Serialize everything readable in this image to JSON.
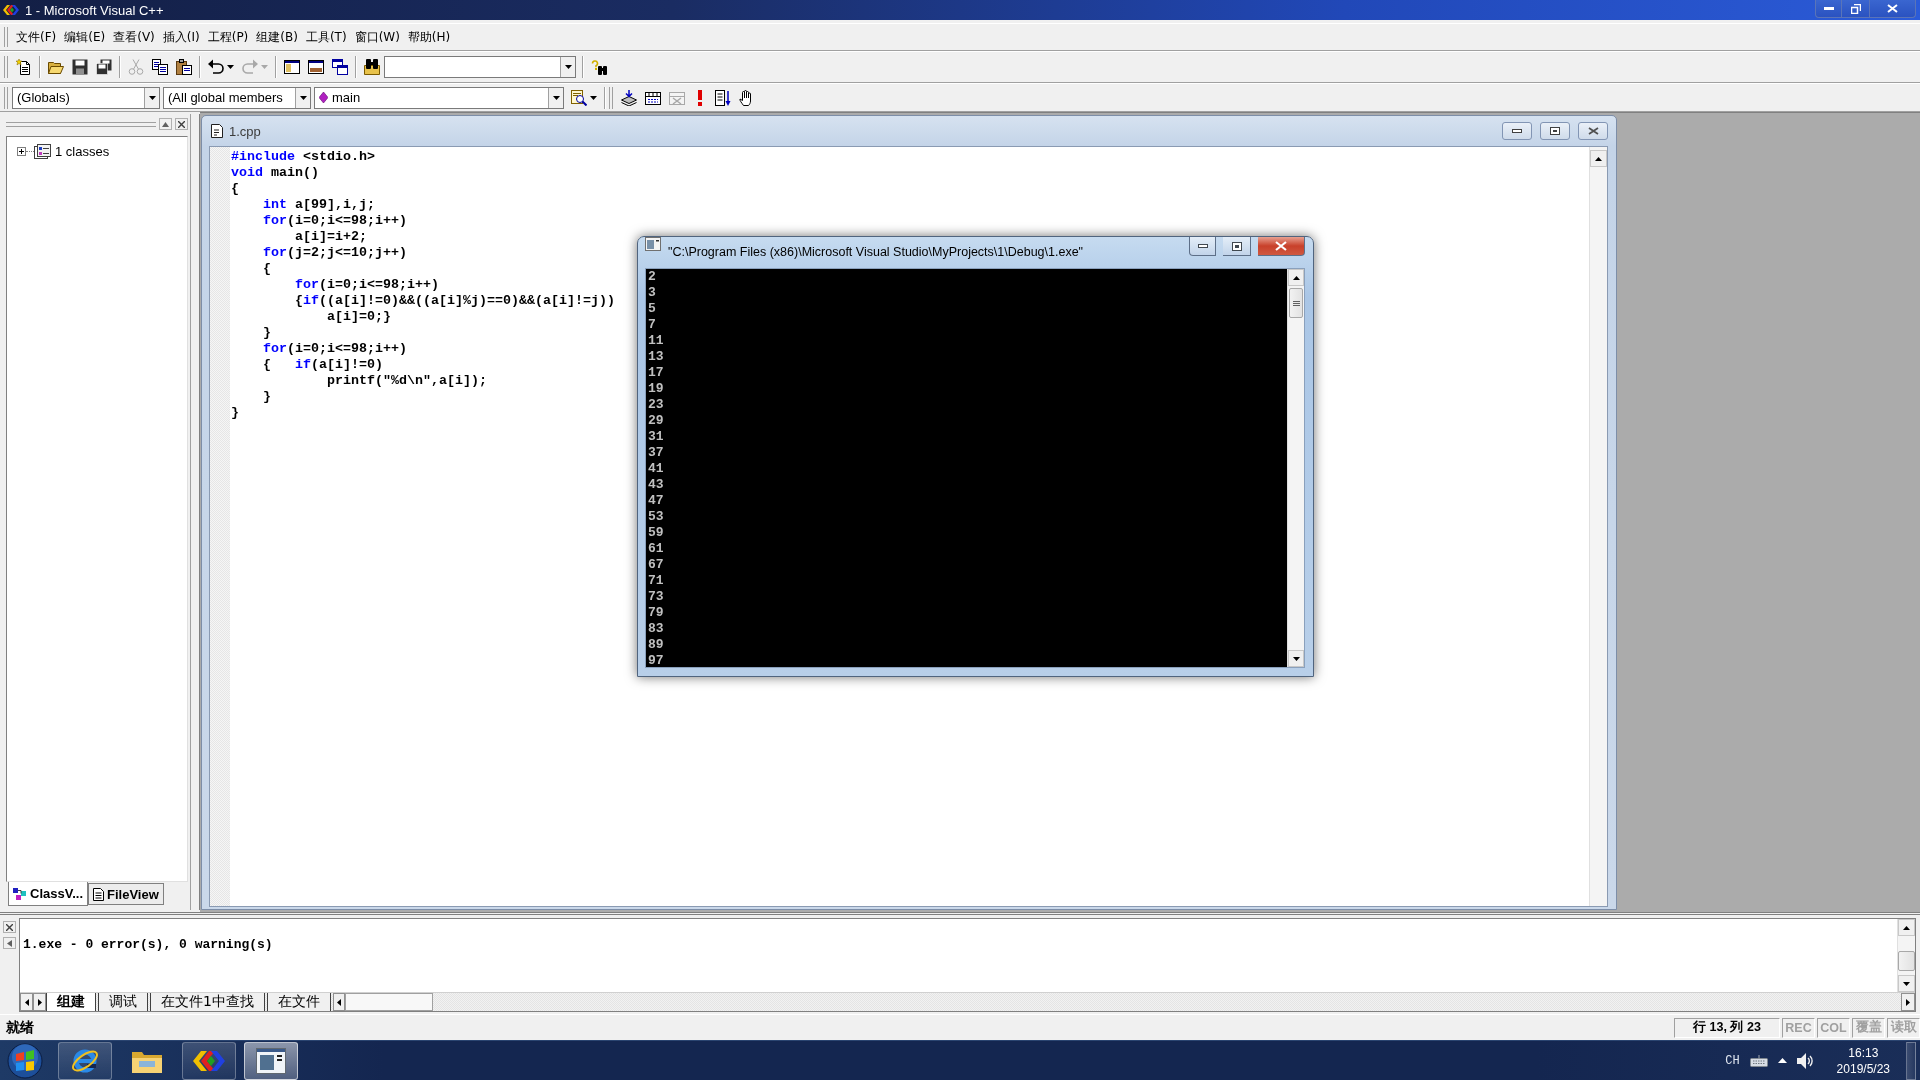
{
  "window": {
    "title": "1 - Microsoft Visual C++"
  },
  "menu": [
    "文件(F)",
    "编辑(E)",
    "查看(V)",
    "插入(I)",
    "工程(P)",
    "组建(B)",
    "工具(T)",
    "窗口(W)",
    "帮助(H)"
  ],
  "standard_toolbar": {
    "buttons": [
      {
        "disabled": false
      },
      {
        "disabled": false
      },
      {
        "disabled": false
      },
      {
        "disabled": false
      },
      {
        "disabled": true
      },
      {
        "disabled": false
      },
      {
        "disabled": false
      },
      {
        "disabled": false
      },
      {
        "disabled": true
      },
      {
        "disabled": false
      },
      {
        "disabled": false
      },
      {
        "disabled": false
      },
      {
        "disabled": false
      },
      {
        "disabled": false
      }
    ]
  },
  "wizard_bar": {
    "combos": [
      {
        "value": "(Globals)"
      },
      {
        "value": "(All global members"
      },
      {
        "value": "main"
      }
    ]
  },
  "build_toolbar": {
    "buttons": [
      {
        "disabled": false
      },
      {
        "disabled": false
      },
      {
        "disabled": true
      },
      {
        "disabled": false
      },
      {
        "disabled": false
      },
      {
        "disabled": false
      }
    ]
  },
  "workspace": {
    "tree": [
      {
        "label": "1 classes",
        "expanded": false
      }
    ],
    "tabs": [
      {
        "label": "ClassV...",
        "selected": true
      },
      {
        "label": "FileView",
        "selected": false
      }
    ]
  },
  "editor": {
    "title": "1.cpp",
    "lines": [
      [
        {
          "kind": "keyword",
          "text": "#include"
        },
        {
          "kind": "code",
          "text": " <stdio.h>"
        }
      ],
      [
        {
          "kind": "keyword",
          "text": "void"
        },
        {
          "kind": "code",
          "text": " main()"
        }
      ],
      [
        {
          "kind": "code",
          "text": "{"
        }
      ],
      [
        {
          "kind": "keyword",
          "text": "    int"
        },
        {
          "kind": "code",
          "text": " a[99],i,j;"
        }
      ],
      [
        {
          "kind": "keyword",
          "text": "    for"
        },
        {
          "kind": "code",
          "text": "(i=0;i<=98;i++)"
        }
      ],
      [
        {
          "kind": "code",
          "text": "        a[i]=i+2;"
        }
      ],
      [
        {
          "kind": "keyword",
          "text": "    for"
        },
        {
          "kind": "code",
          "text": "(j=2;j<=10;j++)"
        }
      ],
      [
        {
          "kind": "code",
          "text": "    {"
        }
      ],
      [
        {
          "kind": "keyword",
          "text": "        for"
        },
        {
          "kind": "code",
          "text": "(i=0;i<=98;i++)"
        }
      ],
      [
        {
          "kind": "code",
          "text": "        {"
        },
        {
          "kind": "keyword",
          "text": "if"
        },
        {
          "kind": "code",
          "text": "((a[i]!=0)&&((a[i]%j)==0)&&(a[i]!=j))"
        }
      ],
      [
        {
          "kind": "code",
          "text": "            a[i]=0;}"
        }
      ],
      [
        {
          "kind": "code",
          "text": "    }"
        }
      ],
      [
        {
          "kind": "keyword",
          "text": "    for"
        },
        {
          "kind": "code",
          "text": "(i=0;i<=98;i++)"
        }
      ],
      [
        {
          "kind": "code",
          "text": "    {   "
        },
        {
          "kind": "keyword",
          "text": "if"
        },
        {
          "kind": "code",
          "text": "(a[i]!=0)"
        }
      ],
      [
        {
          "kind": "code",
          "text": "            printf(\"%d\\n\",a[i]);"
        }
      ],
      [
        {
          "kind": "code",
          "text": "    }"
        }
      ],
      [
        {
          "kind": "code",
          "text": "}"
        }
      ]
    ]
  },
  "console": {
    "title": "\"C:\\Program Files (x86)\\Microsoft Visual Studio\\MyProjects\\1\\Debug\\1.exe\"",
    "lines": [
      "2",
      "3",
      "5",
      "7",
      "11",
      "13",
      "17",
      "19",
      "23",
      "29",
      "31",
      "37",
      "41",
      "43",
      "47",
      "53",
      "59",
      "61",
      "67",
      "71",
      "73",
      "79",
      "83",
      "89",
      "97"
    ]
  },
  "output": {
    "lines": [
      "1.exe - 0 error(s), 0 warning(s)"
    ],
    "tabs": [
      {
        "label": "组建",
        "selected": true
      },
      {
        "label": "调试",
        "selected": false
      },
      {
        "label": "在文件1中查找",
        "selected": false
      },
      {
        "label": "在文件",
        "selected": false
      }
    ]
  },
  "status_bar": {
    "message": "就绪",
    "position": "行 13, 列 23",
    "indicators": [
      {
        "label": "REC",
        "on": false
      },
      {
        "label": "COL",
        "on": false
      },
      {
        "label": "覆盖",
        "on": false
      },
      {
        "label": "读取",
        "on": false
      }
    ]
  },
  "taskbar": {
    "apps": [
      {
        "running": true,
        "selected": false
      },
      {
        "running": false,
        "selected": false
      },
      {
        "running": true,
        "selected": false
      },
      {
        "running": true,
        "selected": true
      }
    ],
    "tray": {
      "language": "CH",
      "time": "16:13",
      "date": "2019/5/23"
    }
  }
}
